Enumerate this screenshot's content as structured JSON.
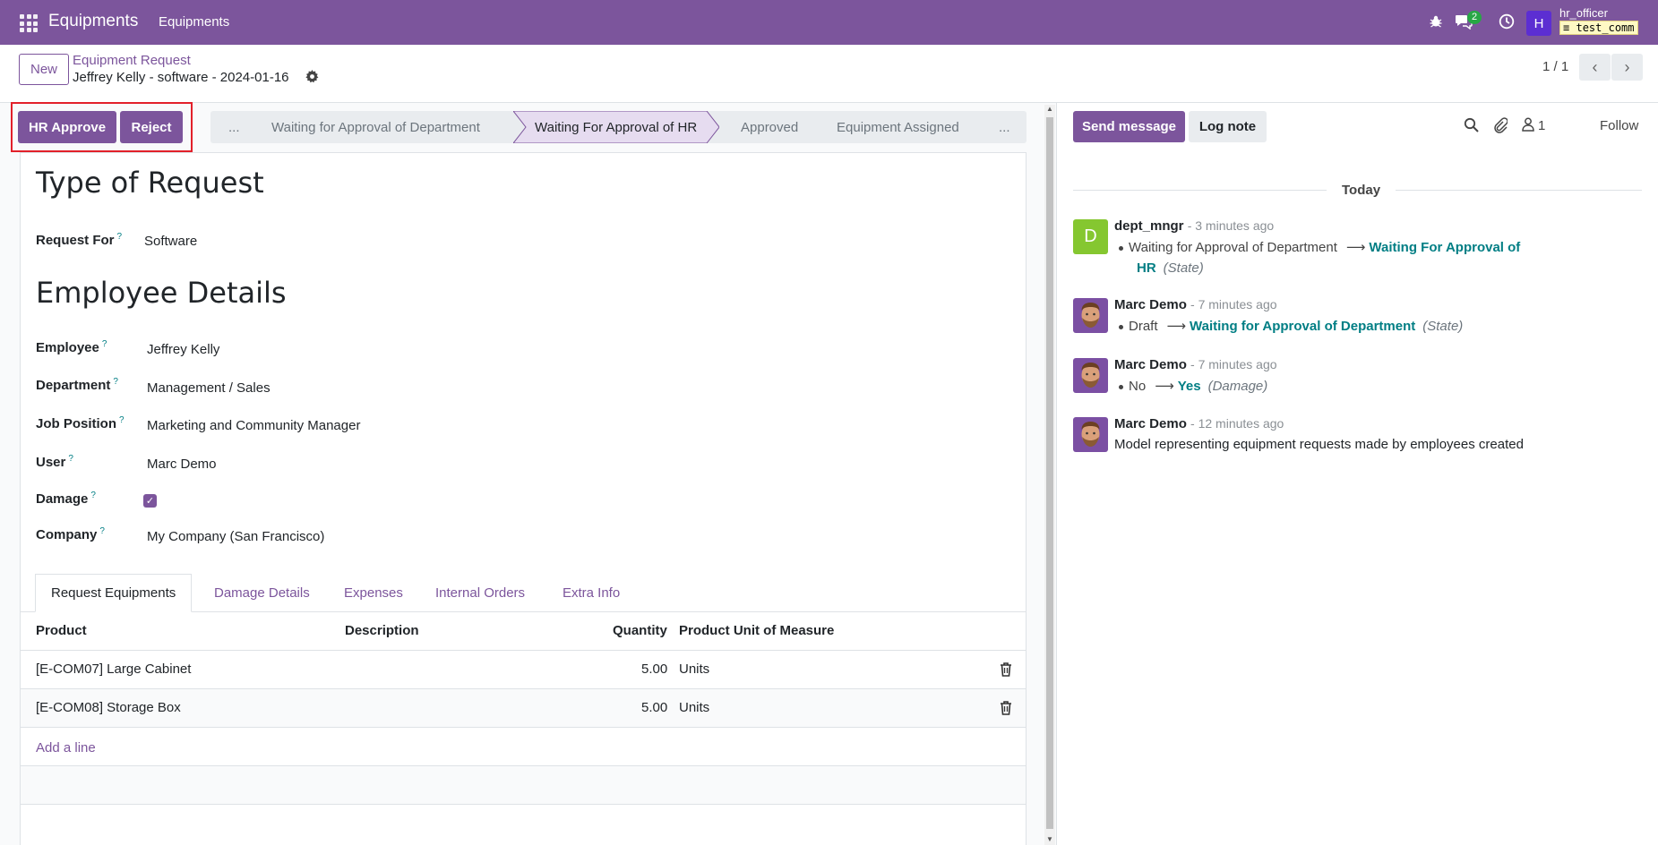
{
  "navbar": {
    "app_title": "Equipments",
    "menu_item": "Equipments",
    "chat_badge": "2",
    "avatar_letter": "H",
    "user_name": "hr_officer",
    "db_name": "test_comm"
  },
  "control": {
    "new_label": "New",
    "breadcrumb_parent": "Equipment Request",
    "breadcrumb_current": "Jeffrey Kelly - software - 2024-01-16",
    "pager_text": "1 / 1"
  },
  "actions": {
    "hr_approve": "HR Approve",
    "reject": "Reject"
  },
  "statusbar": {
    "more_left": "...",
    "stages": [
      "Waiting for Approval of Department",
      "Waiting For Approval of HR",
      "Approved",
      "Equipment Assigned"
    ],
    "current_index": 1,
    "more_right": "..."
  },
  "form": {
    "heading_type": "Type of Request",
    "request_for_label": "Request For",
    "request_for_value": "Software",
    "heading_employee": "Employee Details",
    "help_mark": "?",
    "fields": [
      {
        "label": "Employee",
        "value": "Jeffrey Kelly"
      },
      {
        "label": "Department",
        "value": "Management / Sales"
      },
      {
        "label": "Job Position",
        "value": "Marketing and Community Manager"
      },
      {
        "label": "User",
        "value": "Marc Demo"
      },
      {
        "label": "Damage",
        "value": ""
      },
      {
        "label": "Company",
        "value": "My Company (San Francisco)"
      }
    ],
    "damage_checked": true
  },
  "tabs": [
    "Request Equipments",
    "Damage Details",
    "Expenses",
    "Internal Orders",
    "Extra Info"
  ],
  "active_tab": 0,
  "table": {
    "headers": [
      "Product",
      "Description",
      "Quantity",
      "Product Unit of Measure"
    ],
    "rows": [
      {
        "product": "[E-COM07] Large Cabinet",
        "description": "",
        "quantity": "5.00",
        "uom": "Units"
      },
      {
        "product": "[E-COM08] Storage Box",
        "description": "",
        "quantity": "5.00",
        "uom": "Units"
      }
    ],
    "add_line": "Add a line"
  },
  "chatter": {
    "send_message": "Send message",
    "log_note": "Log note",
    "followers_count": "1",
    "follow": "Follow",
    "separator": "Today",
    "messages": [
      {
        "author": "dept_mngr",
        "time": "- 3 minutes ago",
        "old": "Waiting for Approval of Department",
        "new_line1": "Waiting For Approval of",
        "new_line2": "HR",
        "field": "(State)"
      },
      {
        "author": "Marc Demo",
        "time": "- 7 minutes ago",
        "old": "Draft",
        "new": "Waiting for Approval of Department",
        "field": "(State)"
      },
      {
        "author": "Marc Demo",
        "time": "- 7 minutes ago",
        "old": "No",
        "new": "Yes",
        "field": "(Damage)"
      },
      {
        "author": "Marc Demo",
        "time": "- 12 minutes ago",
        "body": "Model representing equipment requests made by employees created"
      }
    ],
    "avatar_letter_first": "D"
  },
  "colors": {
    "brand": "#7c559c",
    "link": "#017e84",
    "highlight": "#e2202a"
  }
}
